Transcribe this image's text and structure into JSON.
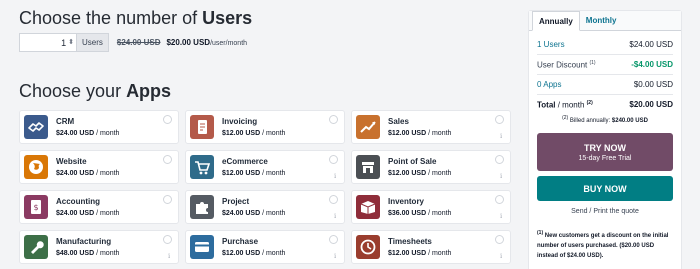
{
  "users": {
    "heading_prefix": "Choose the number of ",
    "heading_bold": "Users",
    "count": "1",
    "spinner_glyph": "⬍",
    "tag": "Users",
    "old_price": "$24.00 USD",
    "new_price": "$20.00 USD",
    "per": "/user/month"
  },
  "apps": {
    "heading_prefix": "Choose your ",
    "heading_bold": "Apps",
    "items": [
      {
        "name": "CRM",
        "price": "$24.00 USD",
        "period": " / month",
        "icon": "crm-handshake-icon",
        "color": "#3b5a8c",
        "info": false
      },
      {
        "name": "Invoicing",
        "price": "$12.00 USD",
        "period": " / month",
        "icon": "invoice-document-icon",
        "color": "#b45a4a",
        "info": false
      },
      {
        "name": "Sales",
        "price": "$12.00 USD",
        "period": " / month",
        "icon": "sales-chart-icon",
        "color": "#c8712e",
        "info": true
      },
      {
        "name": "Website",
        "price": "$24.00 USD",
        "period": " / month",
        "icon": "website-globe-icon",
        "color": "#d97706",
        "info": false
      },
      {
        "name": "eCommerce",
        "price": "$12.00 USD",
        "period": " / month",
        "icon": "ecommerce-cart-icon",
        "color": "#2f6b8a",
        "info": true
      },
      {
        "name": "Point of Sale",
        "price": "$12.00 USD",
        "period": " / month",
        "icon": "point-of-sale-store-icon",
        "color": "#4b4f54",
        "info": true
      },
      {
        "name": "Accounting",
        "price": "$24.00 USD",
        "period": " / month",
        "icon": "accounting-document-icon",
        "color": "#8b3a62",
        "info": false
      },
      {
        "name": "Project",
        "price": "$24.00 USD",
        "period": " / month",
        "icon": "project-puzzle-icon",
        "color": "#555b63",
        "info": true
      },
      {
        "name": "Inventory",
        "price": "$36.00 USD",
        "period": " / month",
        "icon": "inventory-box-icon",
        "color": "#8f2d3a",
        "info": true
      },
      {
        "name": "Manufacturing",
        "price": "$48.00 USD",
        "period": " / month",
        "icon": "manufacturing-wrench-icon",
        "color": "#3d6f47",
        "info": true
      },
      {
        "name": "Purchase",
        "price": "$12.00 USD",
        "period": " / month",
        "icon": "purchase-card-icon",
        "color": "#2d6c9e",
        "info": true
      },
      {
        "name": "Timesheets",
        "price": "$12.00 USD",
        "period": " / month",
        "icon": "timesheets-clock-icon",
        "color": "#9a3d2e",
        "info": true
      }
    ]
  },
  "summary": {
    "tab_annually": "Annually",
    "tab_monthly": "Monthly",
    "users_count": "1",
    "users_label": " Users",
    "users_price": "$24.00 USD",
    "discount_label": "User Discount ",
    "discount_sup": "(1)",
    "discount_value": "-$4.00 USD",
    "apps_count": "0",
    "apps_label": " Apps",
    "apps_price": "$0.00 USD",
    "total_label": "Total",
    "total_sub": " / month ",
    "total_sup": "(2)",
    "total_value": "$20.00 USD",
    "billed_sup": "(2)",
    "billed_text": " Billed annually: ",
    "billed_value": "$240.00 USD",
    "try_now": "TRY NOW",
    "trial": "15-day Free Trial",
    "buy_now": "BUY NOW",
    "quote": "Send / Print the quote",
    "footnote_sup": "(1)",
    "footnote": " New customers get a discount on the initial number of users purchased. ($20.00 USD instead of $24.00 USD)."
  },
  "colors": {
    "try_button": "#714b67",
    "buy_button": "#017e84",
    "link": "#0e7490",
    "discount": "#059669"
  }
}
